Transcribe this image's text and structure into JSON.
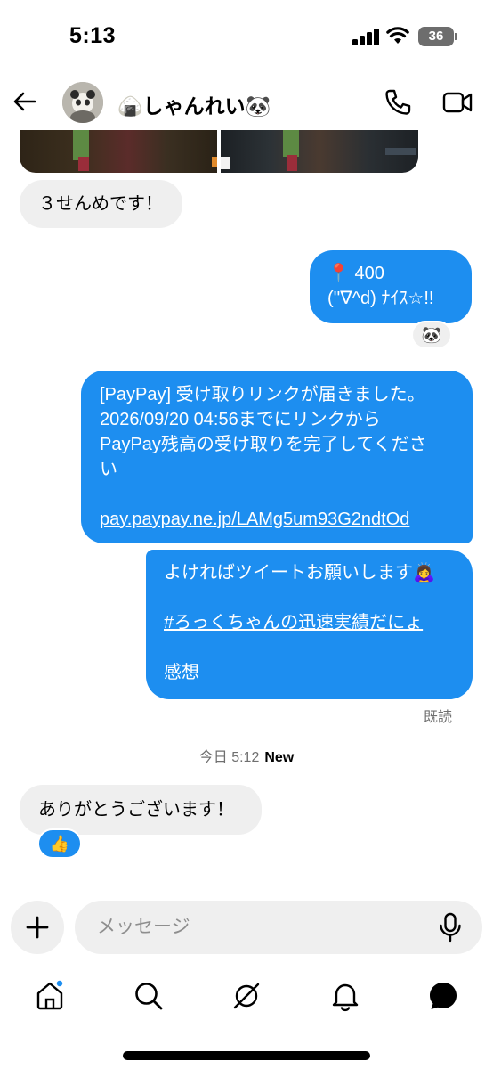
{
  "status": {
    "time": "5:13",
    "battery": "36"
  },
  "header": {
    "name": "🍙しゃんれい🐼",
    "icons": {
      "back": "arrow-left-icon",
      "avatar": "avatar",
      "call": "phone-icon",
      "video": "video-camera-icon"
    }
  },
  "messages": {
    "m1": "３せんめです！",
    "m2_l1": "📍 400",
    "m2_l2": "(''∇^d) ﾅｲｽ☆!!",
    "m2_reaction": "🐼",
    "m3_l1": "[PayPay] 受け取りリンクが届きました。",
    "m3_l2": "2026/09/20 04:56までにリンクから",
    "m3_l3": "PayPay残高の受け取りを完了してくださ",
    "m3_l4": "い",
    "m3_link": "pay.paypay.ne.jp/LAMg5um93G2ndtOd",
    "m4_l1": "よければツイートお願いします🙇‍♀️",
    "m4_tag": "#ろっくちゃんの迅速実績だにょ",
    "m4_l3": "感想",
    "read_receipt": "既読",
    "divider_time": "今日 5:12",
    "divider_new": "New",
    "m5": "ありがとうございます！",
    "m5_reaction": "👍"
  },
  "composer": {
    "placeholder": "メッセージ"
  },
  "nav": {
    "icons": [
      "home-icon",
      "search-icon",
      "explore-icon",
      "bell-icon",
      "messages-icon"
    ]
  },
  "colors": {
    "accent": "#1d8ef0",
    "incoming": "#efefef",
    "notification_dot": "#1d8ef0"
  }
}
